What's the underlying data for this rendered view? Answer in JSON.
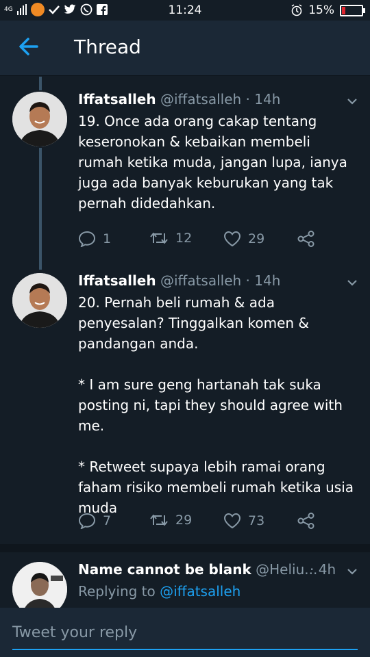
{
  "status_bar": {
    "network": "4G",
    "time": "11:24",
    "battery": "15%",
    "battery_level": 0.15
  },
  "header": {
    "title": "Thread"
  },
  "tweets": [
    {
      "name": "Iffatsalleh",
      "handle": "@iffatsalleh",
      "time": "· 14h",
      "text": "19. Once ada orang cakap tentang keseronokan & kebaikan membeli rumah ketika muda, jangan lupa, ianya juga ada banyak keburukan yang tak pernah didedahkan.",
      "replies": "1",
      "retweets": "12",
      "likes": "29"
    },
    {
      "name": "Iffatsalleh",
      "handle": "@iffatsalleh",
      "time": "· 14h",
      "text": "20. Pernah beli rumah & ada penyesalan? Tinggalkan komen & pandangan anda.\n\n* I am sure geng hartanah tak suka posting ni, tapi they should agree with me.\n\n* Retweet supaya lebih ramai orang faham risiko membeli rumah ketika usia muda",
      "replies": "7",
      "retweets": "29",
      "likes": "73"
    }
  ],
  "reply_tweet": {
    "name": "Name cannot be blank",
    "handle": "@Heliu...",
    "time": "· 4h",
    "replying_prefix": "Replying to",
    "replying_to": "@iffatsalleh"
  },
  "reply_box": {
    "placeholder": "Tweet your reply"
  },
  "colors": {
    "background": "#141d26",
    "header": "#1b2836",
    "accent": "#1da1f2",
    "muted": "#8899a6"
  }
}
